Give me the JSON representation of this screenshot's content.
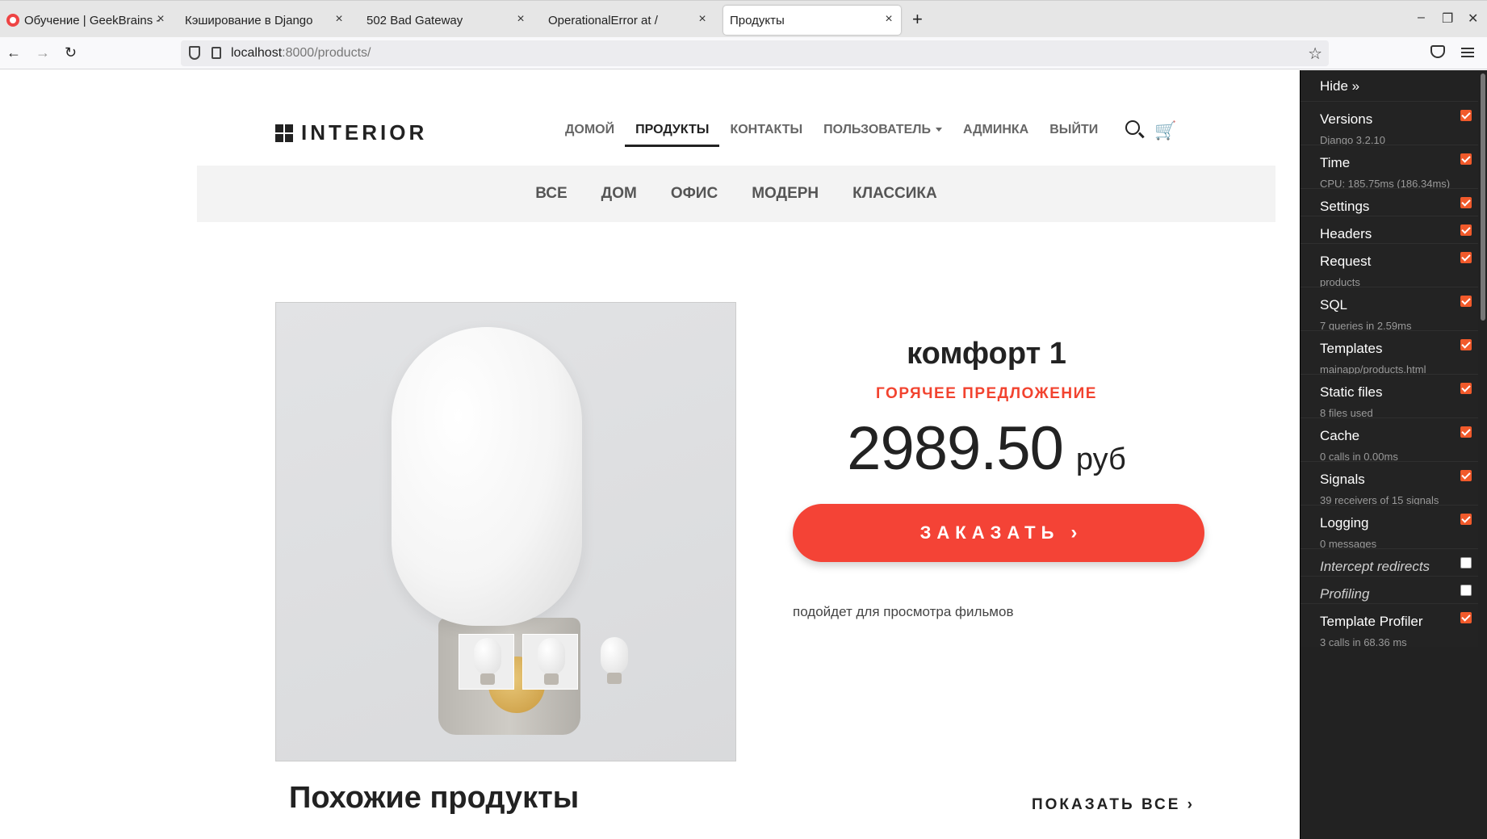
{
  "browser": {
    "tabs": [
      {
        "title": "Обучение | GeekBrains -",
        "favicon": true
      },
      {
        "title": "Кэширование в Django"
      },
      {
        "title": "502 Bad Gateway"
      },
      {
        "title": "OperationalError at /"
      },
      {
        "title": "Продукты",
        "active": true
      }
    ],
    "tab_close_glyph": "×",
    "new_tab_glyph": "+",
    "window_controls": [
      "–",
      "❐",
      "✕"
    ],
    "nav": {
      "back": "←",
      "forward": "→",
      "reload": "↻"
    },
    "url_host": "localhost",
    "url_rest": ":8000/products/",
    "bookmark_glyph": "☆"
  },
  "site": {
    "logo": "INTERIOR",
    "menu": [
      {
        "label": "домой"
      },
      {
        "label": "продукты",
        "active": true
      },
      {
        "label": "контакты"
      },
      {
        "label": "пользователь",
        "dropdown": true
      },
      {
        "label": "админка"
      },
      {
        "label": "выйти"
      }
    ],
    "cart_glyph": "🛒",
    "categories": [
      "все",
      "дом",
      "офис",
      "модерн",
      "классика"
    ],
    "product": {
      "title": "комфорт 1",
      "hot_label": "ГОРЯЧЕЕ ПРЕДЛОЖЕНИЕ",
      "price": "2989.50",
      "currency": "руб",
      "order_button": "ЗАКАЗАТЬ",
      "order_chevron": "›",
      "description": "подойдет для просмотра фильмов"
    },
    "similar_title": "Похожие продукты",
    "show_all": "ПОКАЗАТЬ ВСЕ",
    "show_all_chevron": "›"
  },
  "debug_toolbar": {
    "hide_label": "Hide »",
    "panels": [
      {
        "label": "Versions",
        "sub": "Django 3.2.10",
        "checked": true
      },
      {
        "label": "Time",
        "sub": "CPU: 185.75ms (186.34ms)",
        "checked": true
      },
      {
        "label": "Settings",
        "sub": "",
        "checked": true
      },
      {
        "label": "Headers",
        "sub": "",
        "checked": true
      },
      {
        "label": "Request",
        "sub": "products",
        "checked": true
      },
      {
        "label": "SQL",
        "sub": "7 queries in 2.59ms",
        "checked": true
      },
      {
        "label": "Templates",
        "sub": "mainapp/products.html",
        "checked": true
      },
      {
        "label": "Static files",
        "sub": "8 files used",
        "checked": true
      },
      {
        "label": "Cache",
        "sub": "0 calls in 0.00ms",
        "checked": true
      },
      {
        "label": "Signals",
        "sub": "39 receivers of 15 signals",
        "checked": true
      },
      {
        "label": "Logging",
        "sub": "0 messages",
        "checked": true
      },
      {
        "label": "Intercept redirects",
        "sub": "",
        "checked": false,
        "italic": true
      },
      {
        "label": "Profiling",
        "sub": "",
        "checked": false,
        "italic": true
      },
      {
        "label": "Template Profiler",
        "sub": "3 calls in 68.36 ms",
        "checked": true
      }
    ],
    "accent": "#f15a2b"
  },
  "colors": {
    "accent_red": "#f44336",
    "hot_red": "#f2432f"
  }
}
